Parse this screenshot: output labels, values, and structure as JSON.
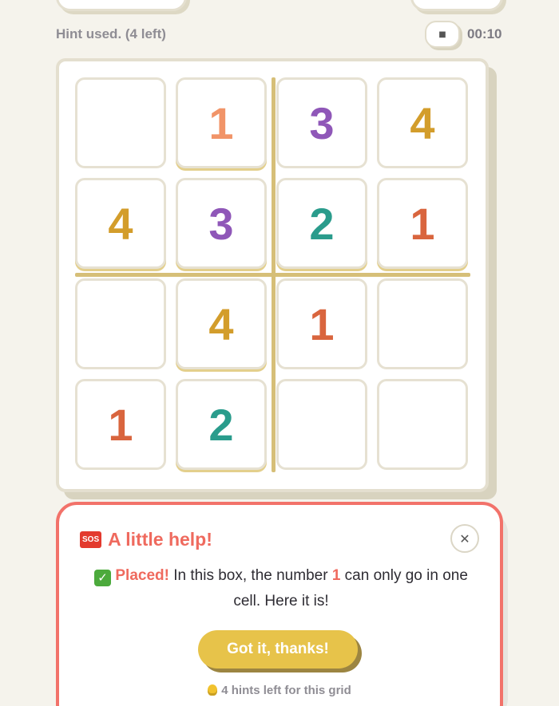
{
  "status": {
    "hint_used": "Hint used. (4 left)",
    "timer": "00:10",
    "pause_icon": "pause-icon"
  },
  "colors": {
    "1": "#d9653e",
    "2": "#2a9c8c",
    "3": "#8f57b8",
    "4": "#d39d2b",
    "hint_highlight": "#f19468",
    "accent": "#ef6a5e",
    "button": "#e7c34a"
  },
  "grid": {
    "rows": [
      [
        "",
        "1",
        "3",
        "4"
      ],
      [
        "4",
        "3",
        "2",
        "1"
      ],
      [
        "",
        "4",
        "1",
        ""
      ],
      [
        "1",
        "2",
        "",
        ""
      ]
    ],
    "hinted_cell": "row 1, column 2"
  },
  "modal": {
    "title": "A little help!",
    "sos_icon": "sos-icon",
    "check_icon": "check-mark-icon",
    "placed": "Placed!",
    "message_before": "In this box, the number",
    "number": "1",
    "message_after": "can only go in one cell. Here it is!",
    "button_label": "Got it, thanks!",
    "hints_left": "4 hints left for this grid",
    "close_icon": "close-icon",
    "bulb_icon": "bulb-icon"
  }
}
